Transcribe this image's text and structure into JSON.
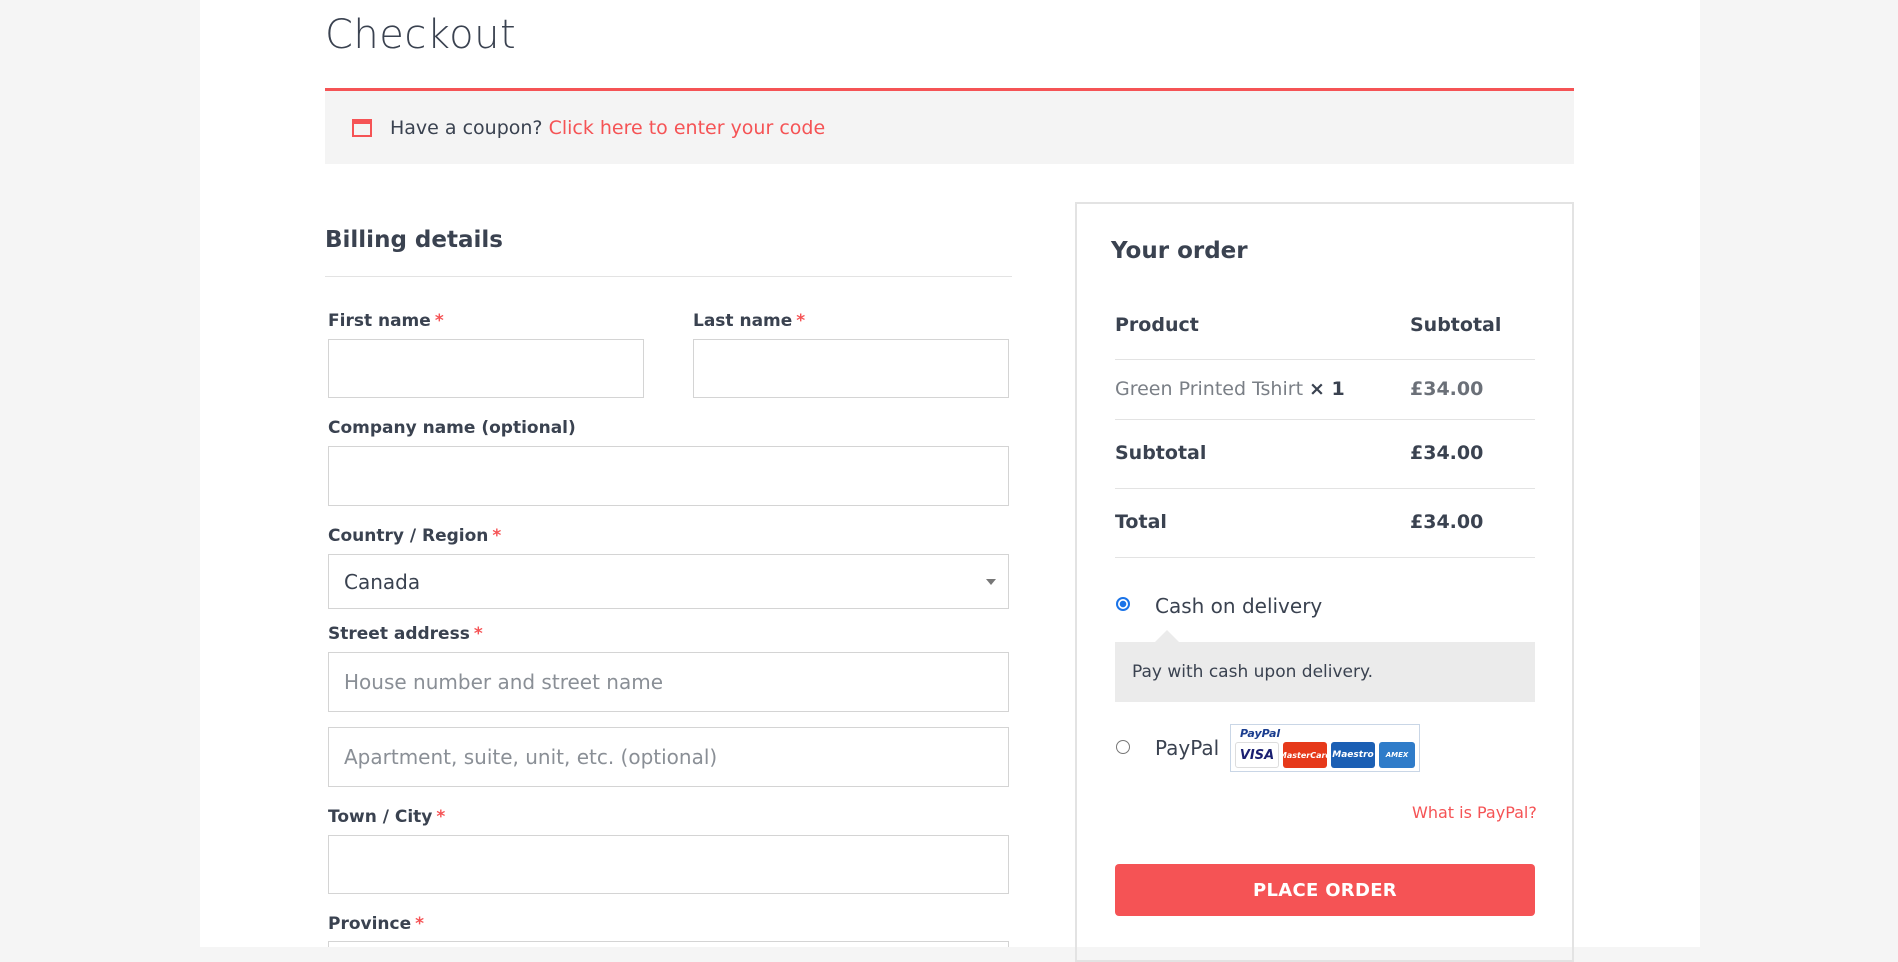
{
  "page": {
    "title": "Checkout"
  },
  "coupon": {
    "prompt": "Have a coupon?",
    "link": "Click here to enter your code",
    "icon": "calendar-icon"
  },
  "billing": {
    "heading": "Billing details",
    "required_mark": "*",
    "fields": {
      "first_name": {
        "label": "First name",
        "value": "",
        "placeholder": ""
      },
      "last_name": {
        "label": "Last name",
        "value": "",
        "placeholder": ""
      },
      "company": {
        "label": "Company name (optional)",
        "value": "",
        "placeholder": ""
      },
      "country": {
        "label": "Country / Region",
        "value": "Canada"
      },
      "street": {
        "label": "Street address",
        "placeholder1": "House number and street name",
        "placeholder2": "Apartment, suite, unit, etc. (optional)"
      },
      "city": {
        "label": "Town / City",
        "value": "",
        "placeholder": ""
      },
      "province": {
        "label": "Province"
      }
    }
  },
  "order": {
    "heading": "Your order",
    "col_product": "Product",
    "col_subtotal": "Subtotal",
    "items": [
      {
        "name": "Green Printed Tshirt",
        "qty": "× 1",
        "price": "£34.00"
      }
    ],
    "subtotal_label": "Subtotal",
    "subtotal_value": "£34.00",
    "total_label": "Total",
    "total_value": "£34.00",
    "payment": {
      "cod_label": "Cash on delivery",
      "cod_selected": true,
      "cod_description": "Pay with cash upon delivery.",
      "paypal_label": "PayPal",
      "paypal_logo_text": "PayPal",
      "cards": [
        "VISA",
        "MasterCard",
        "Maestro",
        "AMEX"
      ],
      "what_is_paypal": "What is PayPal?"
    },
    "place_order": "PLACE ORDER"
  },
  "colors": {
    "accent": "#f55355",
    "text": "#3a4250",
    "radio": "#1a73e8"
  }
}
